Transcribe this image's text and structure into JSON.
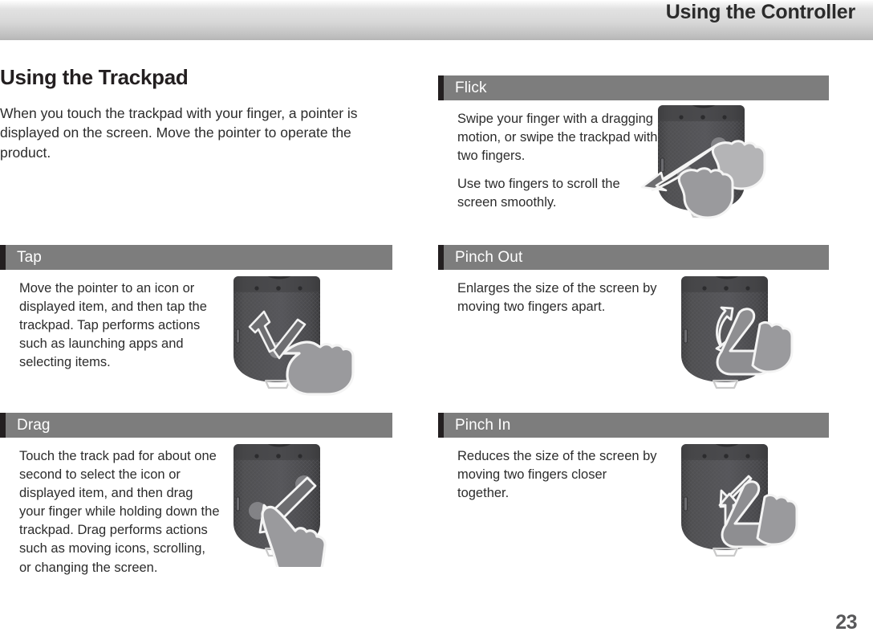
{
  "header": {
    "title": "Using the Controller"
  },
  "intro": {
    "title": "Using the Trackpad",
    "text": "When you touch the trackpad with your finger, a pointer is displayed on the screen. Move the pointer to operate the product."
  },
  "sections": {
    "tap": {
      "label": "Tap",
      "paragraphs": [
        "Move the pointer to an icon or displayed item, and then tap the trackpad. Tap performs actions such as launching apps and selecting items."
      ],
      "figure_name": "controller-tap-illustration"
    },
    "drag": {
      "label": "Drag",
      "paragraphs": [
        "Touch the track pad for about one second to select the icon or displayed item, and then drag your finger while holding down the trackpad. Drag performs actions such as moving icons, scrolling, or changing the screen."
      ],
      "figure_name": "controller-drag-illustration"
    },
    "flick": {
      "label": "Flick",
      "paragraphs": [
        "Swipe your finger with a dragging motion, or swipe the trackpad with two fingers.",
        "Use two fingers to scroll the screen smoothly."
      ],
      "figure_name": "controller-flick-illustration"
    },
    "pinch_out": {
      "label": "Pinch Out",
      "paragraphs": [
        "Enlarges the size of the screen by moving two fingers apart."
      ],
      "figure_name": "controller-pinch-out-illustration"
    },
    "pinch_in": {
      "label": "Pinch In",
      "paragraphs": [
        "Reduces the size of the screen by moving two fingers closer together."
      ],
      "figure_name": "controller-pinch-in-illustration"
    }
  },
  "footer": {
    "page_number": "23"
  },
  "colors": {
    "header_band_top": "#e2e2e2",
    "header_band_bottom": "#b4b4b4",
    "section_bar": "#7d7d7d",
    "section_bar_accent": "#231f20",
    "section_bar_text": "#ffffff",
    "body_text": "#2c2c2c",
    "page_number": "#58585a",
    "device_body": "#4a4a4c",
    "hand_fill": "#8c8c8c",
    "arrow_outline": "#ffffff"
  }
}
